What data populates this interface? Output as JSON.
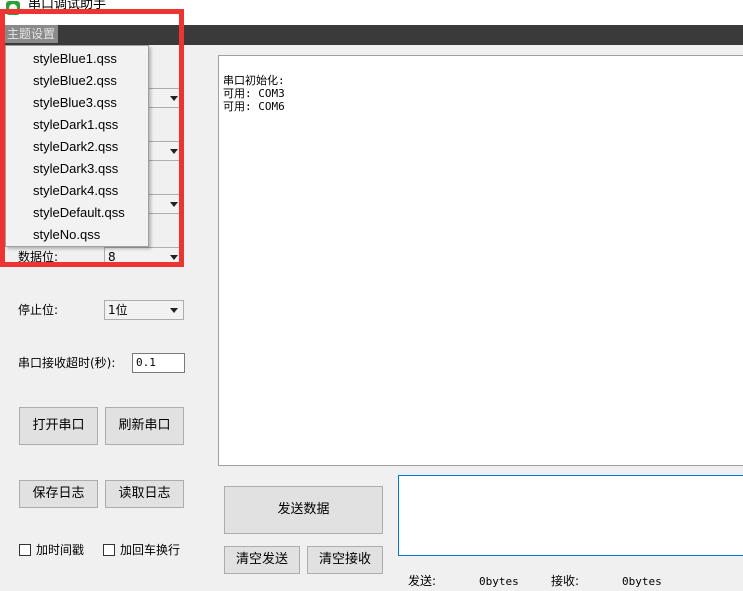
{
  "window": {
    "title": "串口调试助手"
  },
  "menu": {
    "theme_label": "主题设置"
  },
  "theme_menu": {
    "items": [
      "styleBlue1.qss",
      "styleBlue2.qss",
      "styleBlue3.qss",
      "styleDark1.qss",
      "styleDark2.qss",
      "styleDark3.qss",
      "styleDark4.qss",
      "styleDefault.qss",
      "styleNo.qss"
    ]
  },
  "settings": {
    "data_bits_label": "数据位:",
    "data_bits_value": "8",
    "stop_bits_label": "停止位:",
    "stop_bits_value": "1位",
    "timeout_label": "串口接收超时(秒):",
    "timeout_value": "0.1"
  },
  "buttons": {
    "open_port": "打开串口",
    "refresh_port": "刷新串口",
    "save_log": "保存日志",
    "load_log": "读取日志",
    "send_data": "发送数据",
    "clear_send": "清空发送",
    "clear_recv": "清空接收"
  },
  "checkboxes": {
    "timestamp": "加时间戳",
    "newline": "加回车换行"
  },
  "receive": {
    "lines": [
      "串口初始化:",
      "可用: COM3",
      "可用: COM6"
    ]
  },
  "status": {
    "send_label": "发送:",
    "send_value": "0bytes",
    "recv_label": "接收:",
    "recv_value": "0bytes"
  },
  "colors": {
    "menubar": "#3a3a3a",
    "highlight": "#ee3333",
    "send_border": "#0078d7"
  }
}
